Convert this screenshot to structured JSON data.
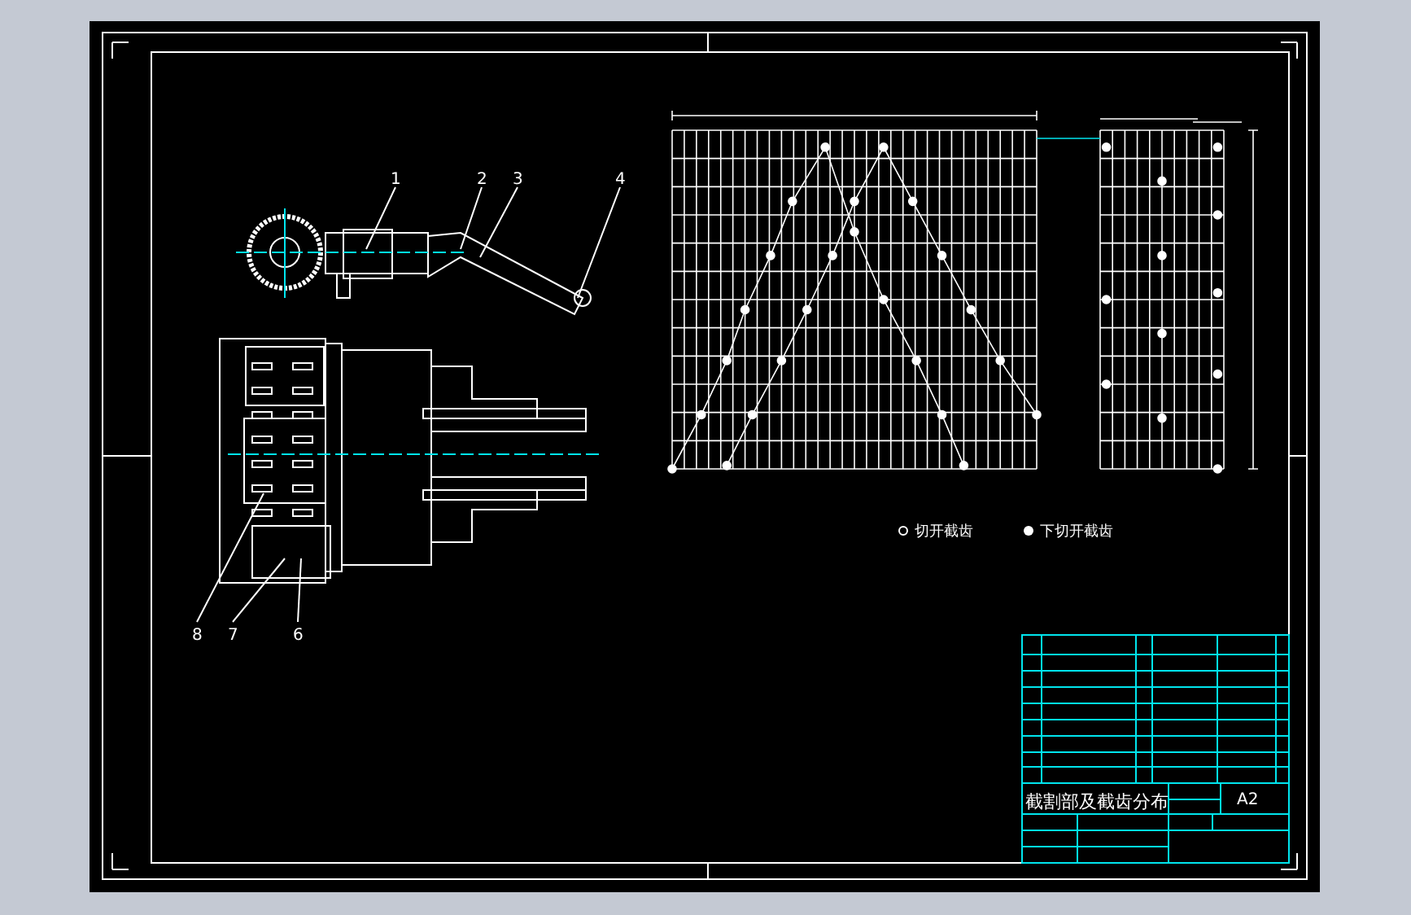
{
  "drawing": {
    "part_labels": [
      {
        "text": "1"
      },
      {
        "text": "2"
      },
      {
        "text": "3"
      },
      {
        "text": "4"
      },
      {
        "text": "8"
      },
      {
        "text": "7"
      },
      {
        "text": "6"
      }
    ],
    "legend": [
      {
        "kind": "hollow",
        "label": "切开截齿"
      },
      {
        "kind": "filled",
        "label": "下切开截齿"
      }
    ],
    "title_block": {
      "title": "截割部及截齿分布",
      "scale": "A2"
    }
  }
}
